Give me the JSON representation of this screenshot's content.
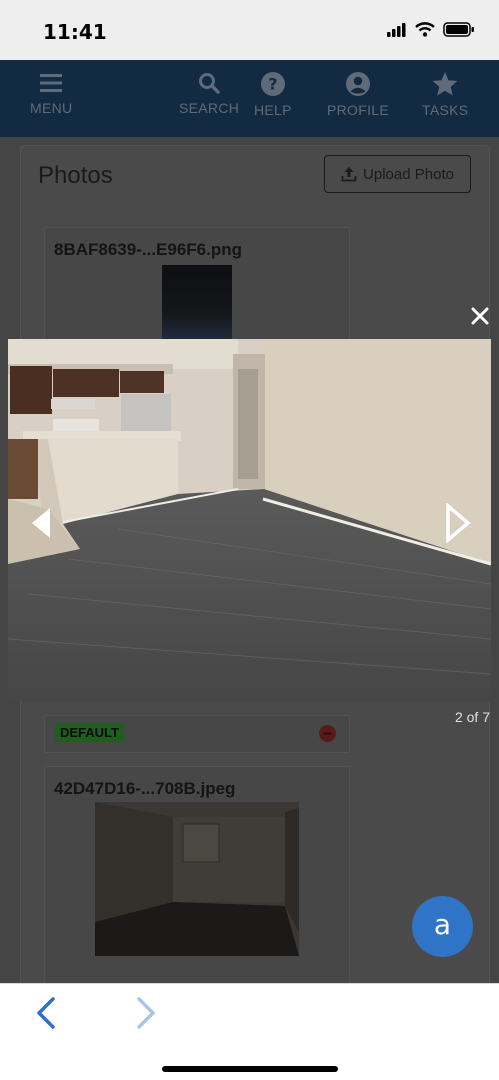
{
  "status_bar": {
    "time": "11:41"
  },
  "nav": [
    {
      "label": "MENU",
      "icon": "hamburger-icon"
    },
    {
      "label": "SEARCH",
      "icon": "search-icon"
    },
    {
      "label": "HELP",
      "icon": "question-icon"
    },
    {
      "label": "PROFILE",
      "icon": "user-icon"
    },
    {
      "label": "TASKS",
      "icon": "star-icon"
    }
  ],
  "page": {
    "title": "Photos",
    "upload_label": "Upload Photo"
  },
  "photos": [
    {
      "name": "8BAF8639-...E96F6.png"
    },
    {
      "badge": "DEFAULT"
    },
    {
      "name": "42D47D16-...708B.jpeg"
    }
  ],
  "lightbox": {
    "counter": "2 of 7"
  },
  "chat": {
    "glyph": "a"
  },
  "colors": {
    "nav_bg": "#122a42",
    "accent": "#2f74c7",
    "badge": "#1f5e1f"
  }
}
